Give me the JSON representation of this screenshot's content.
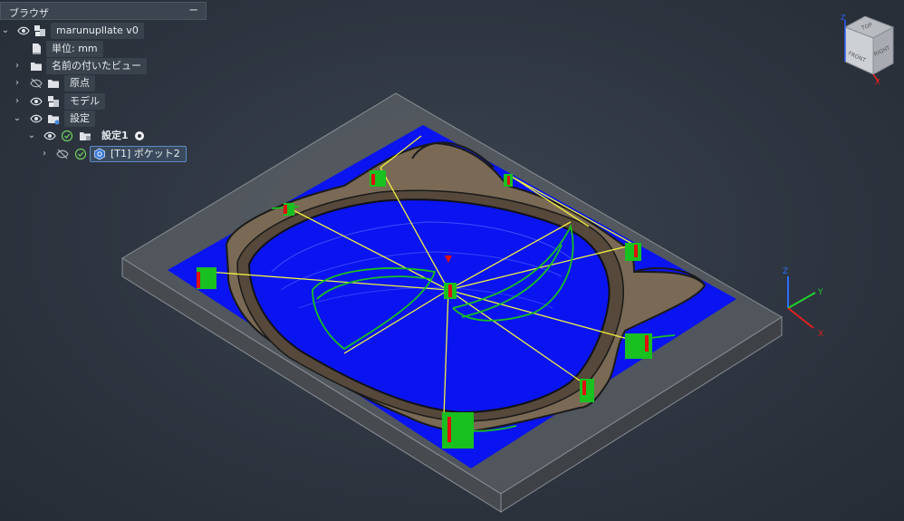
{
  "browser": {
    "title": "ブラウザ",
    "collapse": "−",
    "items": [
      {
        "label": "marunupllate v0"
      },
      {
        "label": "単位: mm"
      },
      {
        "label": "名前の付いたビュー"
      },
      {
        "label": "原点"
      },
      {
        "label": "モデル"
      },
      {
        "label": "設定"
      },
      {
        "label": "設定1"
      },
      {
        "label": "[T1] ポケット2"
      }
    ]
  },
  "viewcube": {
    "top": "TOP",
    "front": "FRONT",
    "right": "RIGHT",
    "z": "Z",
    "x": "X"
  },
  "triad": {
    "z": "Z",
    "y": "Y",
    "x": "X"
  },
  "colors": {
    "toolpath_blue": "#0a14f0",
    "rapid_yellow": "#f0f040",
    "lead_green": "#18c020",
    "stock_gray": "#5a5e63"
  }
}
